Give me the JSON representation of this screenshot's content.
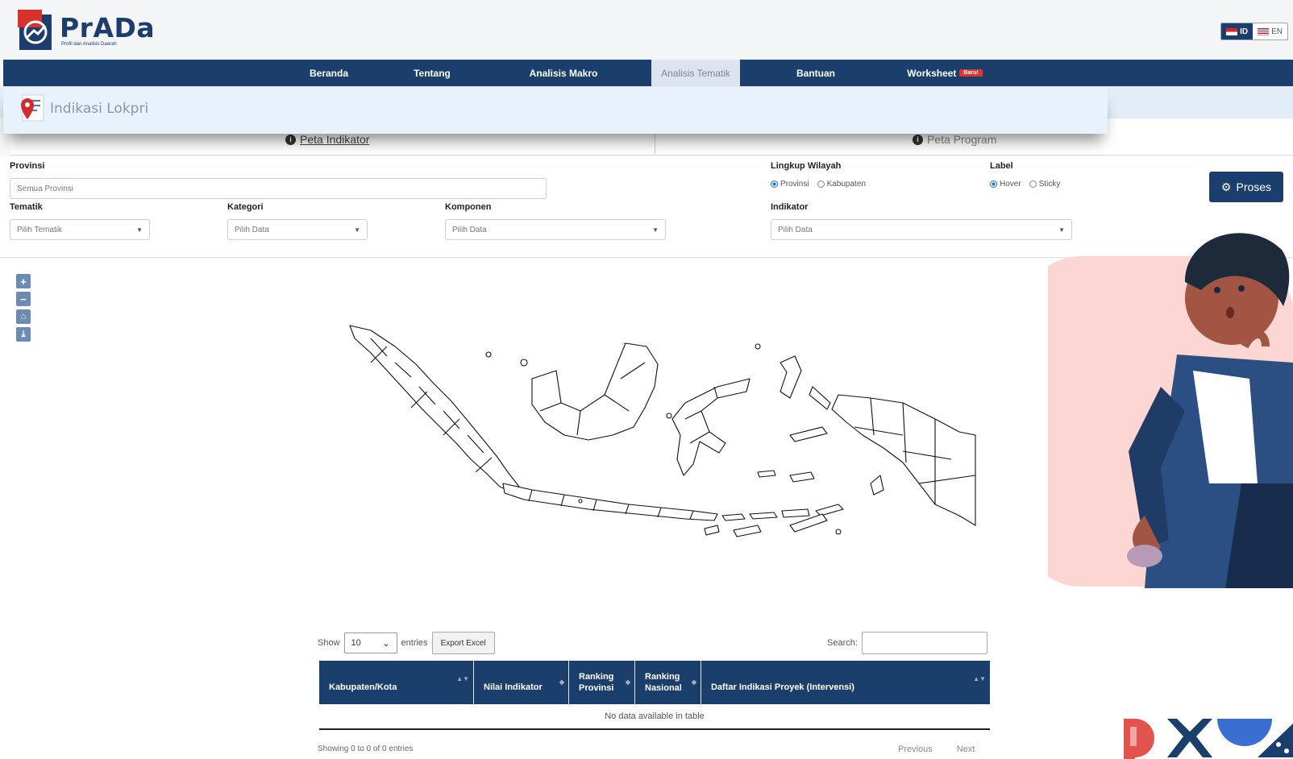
{
  "header": {
    "brand": "PrADa",
    "tagline": "Profil dan Analisis Daerah",
    "lang": {
      "id_label": "ID",
      "en_label": "EN"
    }
  },
  "nav": {
    "items": [
      {
        "label": "Beranda"
      },
      {
        "label": "Tentang"
      },
      {
        "label": "Analisis Makro"
      },
      {
        "label": "Analisis Tematik",
        "active": true
      },
      {
        "label": "Bantuan"
      },
      {
        "label": "Worksheet",
        "badge": "Baru!"
      }
    ]
  },
  "banner": {
    "title": "Indikasi Lokpri"
  },
  "tabs": {
    "indikator": "Peta Indikator",
    "program": "Peta Program"
  },
  "filters": {
    "provinsi": {
      "label": "Provinsi",
      "placeholder": "Semua Provinsi"
    },
    "lingkup": {
      "label": "Lingkup Wilayah",
      "opt1": "Provinsi",
      "opt2": "Kabupaten"
    },
    "label": {
      "label": "Label",
      "opt1": "Hover",
      "opt2": "Sticky"
    },
    "tematik": {
      "label": "Tematik",
      "value": "Pilih Tematik"
    },
    "kategori": {
      "label": "Kategori",
      "value": "Pilih Data"
    },
    "komponen": {
      "label": "Komponen",
      "value": "Pilih Data"
    },
    "indikator": {
      "label": "Indikator",
      "value": "Pilih Data"
    },
    "proses_label": "Proses"
  },
  "map_controls": {
    "zoom_in": "+",
    "zoom_out": "−"
  },
  "table": {
    "show_label": "Show",
    "page_size": "10",
    "entries_label": "entries",
    "export_label": "Export Excel",
    "search_label": "Search:",
    "headers": {
      "kabupaten": "Kabupaten/Kota",
      "nilai": "Nilai Indikator",
      "rank_prov_1": "Ranking",
      "rank_prov_2": "Provinsi",
      "rank_nas_1": "Ranking",
      "rank_nas_2": "Nasional",
      "daftar": "Daftar Indikasi Proyek (Intervensi)"
    },
    "empty": "No data available in table",
    "info": "Showing 0 to 0 of 0 entries",
    "prev": "Previous",
    "next": "Next"
  },
  "colors": {
    "primary": "#1b3f6d",
    "accent_red": "#e0342f",
    "banner_bg": "#e8f2fd"
  }
}
